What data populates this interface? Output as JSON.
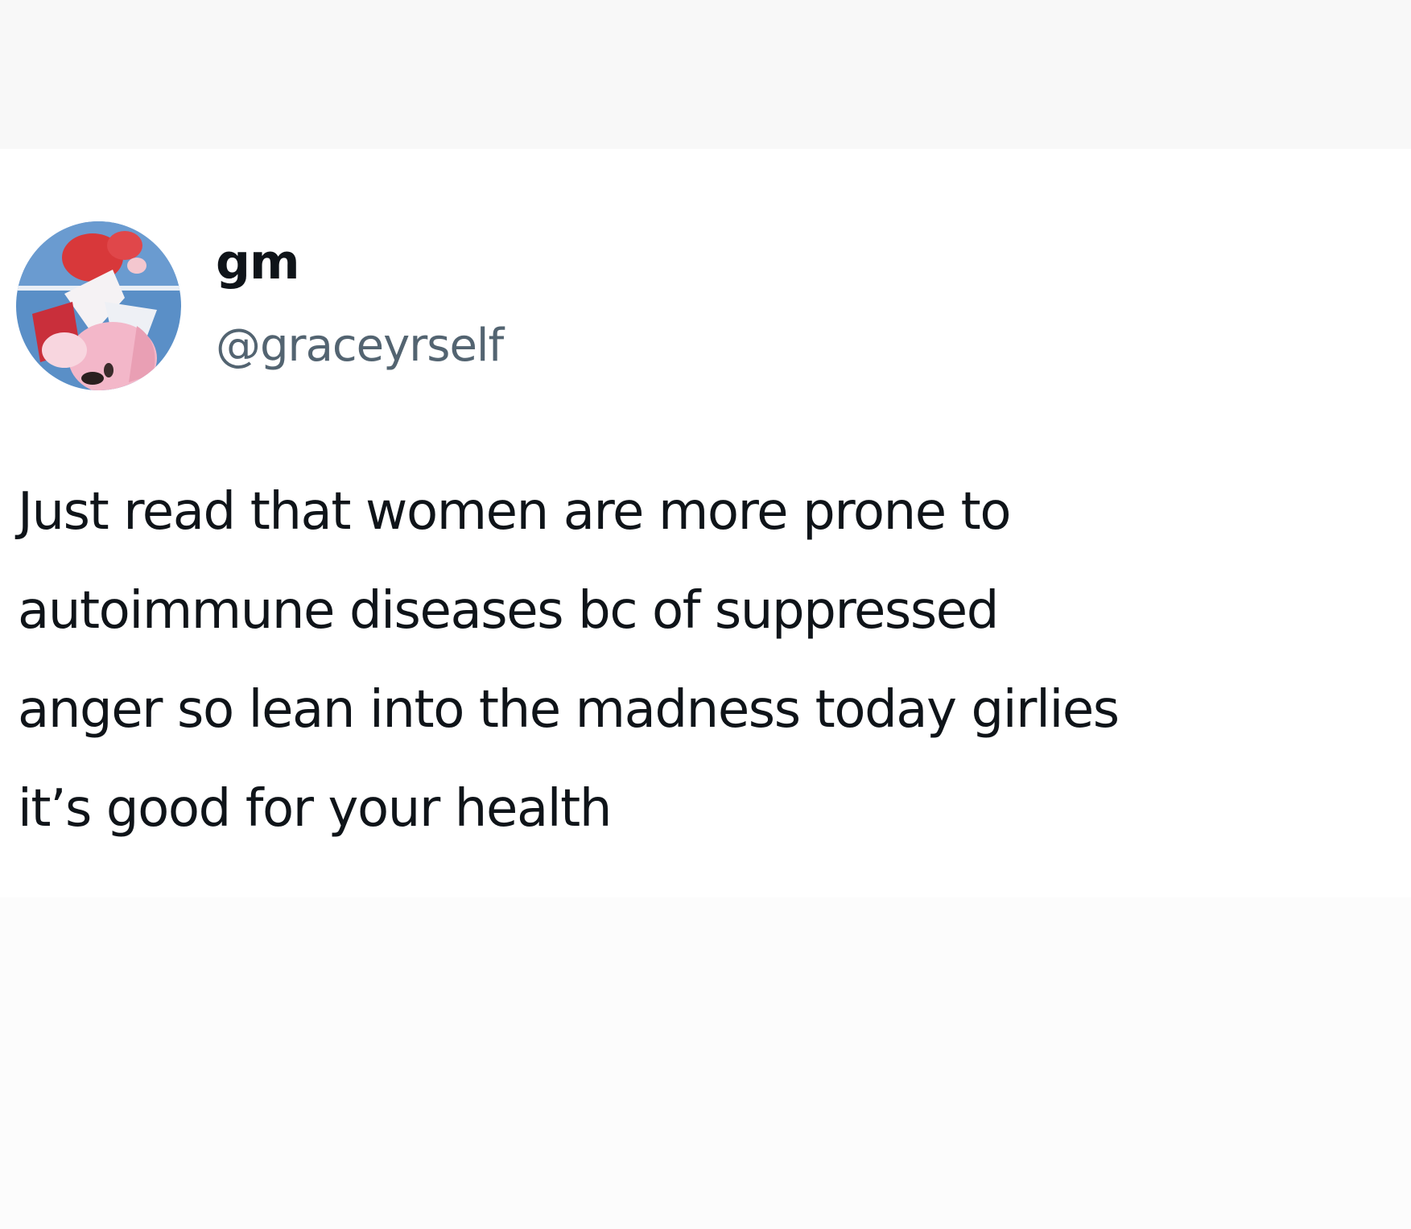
{
  "tweet": {
    "display_name": "gm",
    "handle": "@graceyrself",
    "avatar_icon": "anime-character-avatar-icon",
    "lines": [
      "Just read that women are more prone to",
      "autoimmune diseases bc of suppressed",
      "anger so lean into the madness today girlies",
      "it’s good for your health"
    ]
  },
  "colors": {
    "text_primary": "#0f1419",
    "text_secondary": "#536471",
    "background": "#ffffff",
    "avatar_blue": "#5a8fc7",
    "avatar_red": "#d8383a",
    "avatar_pink": "#f3b7c9"
  }
}
